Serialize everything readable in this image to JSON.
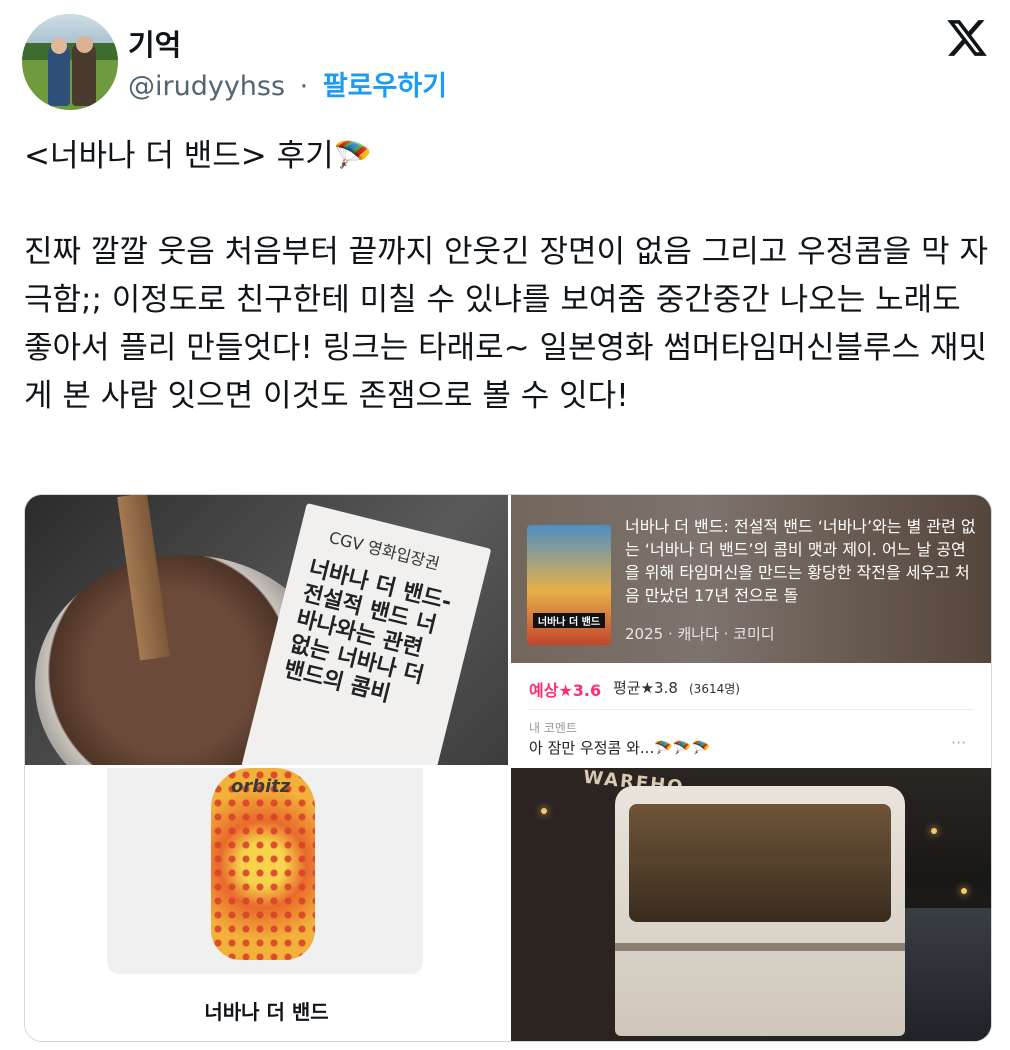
{
  "user": {
    "display_name": "기억",
    "handle": "@irudyyhss",
    "separator": "·",
    "follow_label": "팔로우하기"
  },
  "tweet": {
    "text": "<너바나 더 밴드> 후기🪂\n\n진짜 깔깔 웃음 처음부터 끝까지 안웃긴 장면이 없음 그리고 우정콤을 막 자극함;; 이정도로 친구한테 미칠 수 있냐를 보여줌 중간중간 나오는 노래도 좋아서 플리 만들엇다! 링크는 타래로~ 일본영화 썸머타임머신블루스 재밋게 본 사람 잇으면 이것도 존잼으로 볼 수 잇다!"
  },
  "media": {
    "ticket": {
      "header": "CGV 영화입장권",
      "title": "너바나 더 밴드-전설적 밴드 너바나와는 관련 없는 너바나 더 밴드의 콤비"
    },
    "movie": {
      "poster_title": "너바나 더 밴드",
      "description": "너바나 더 밴드: 전설적 밴드 ‘너바나’와는 별 관련 없는 ‘너바나 더 밴드’의 콤비 맷과 제이. 어느 날 공연을 위해 타임머신을 만드는 황당한 작전을 세우고 처음 만났던 17년 전으로 돌",
      "meta": "2025 · 캐나다 · 코미디",
      "expected_rating": "예상★3.6",
      "average_rating": "평균★3.8",
      "rating_count": "(3614명)",
      "comment_label": "내 코멘트",
      "comment_text": "아 잠만 우정콤 와...🪂🪂🪂",
      "more": "···"
    },
    "bottle": {
      "brand": "orbitz",
      "caption": "너바나 더 밴드"
    },
    "street": {
      "sign": "WAREHO"
    }
  },
  "colors": {
    "link": "#1d9bf0",
    "secondary_text": "#536471",
    "rating_accent": "#ff2f6e"
  },
  "icons": {
    "brand": "x-logo-icon"
  }
}
